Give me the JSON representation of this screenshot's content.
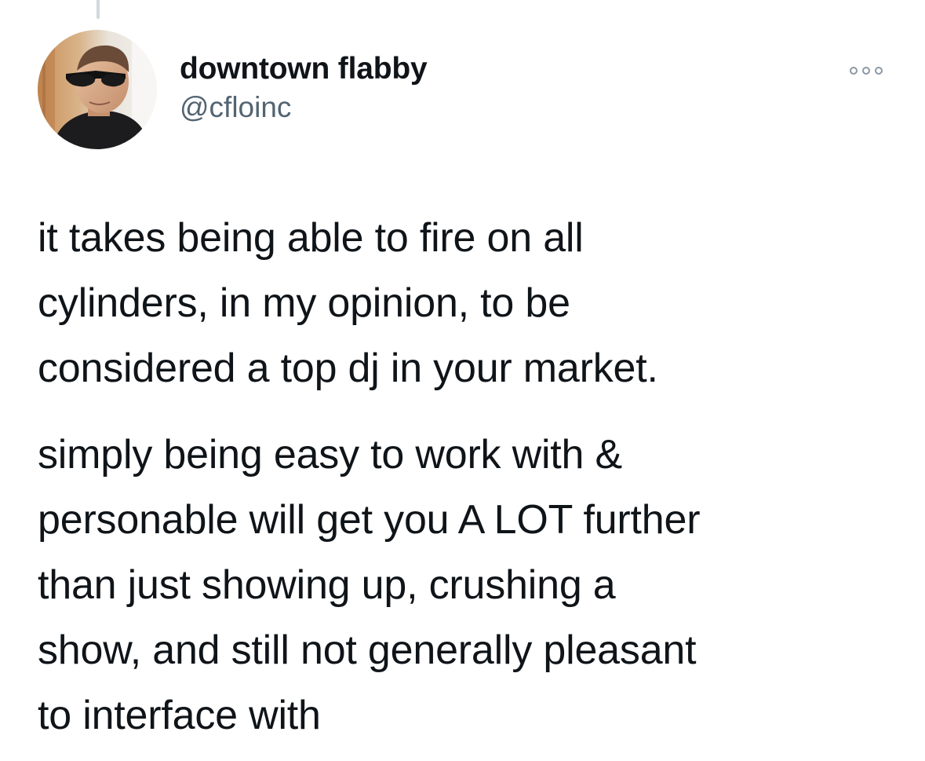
{
  "tweet": {
    "author": {
      "display_name": "downtown flabby",
      "handle": "@cfloinc",
      "avatar_icon": "profile-photo-avatar"
    },
    "more_icon": "more-horizontal-icon",
    "paragraphs": [
      "it takes being able to fire on all\ncylinders, in my opinion, to be\nconsidered a top dj in your market.",
      "simply being easy to work with &\npersonable will get you A LOT further\nthan just showing up, crushing a\nshow, and still not generally pleasant\nto interface with"
    ]
  },
  "colors": {
    "text_primary": "#0f1419",
    "text_secondary": "#536471",
    "thread_line": "#cfd9de",
    "background": "#ffffff"
  }
}
